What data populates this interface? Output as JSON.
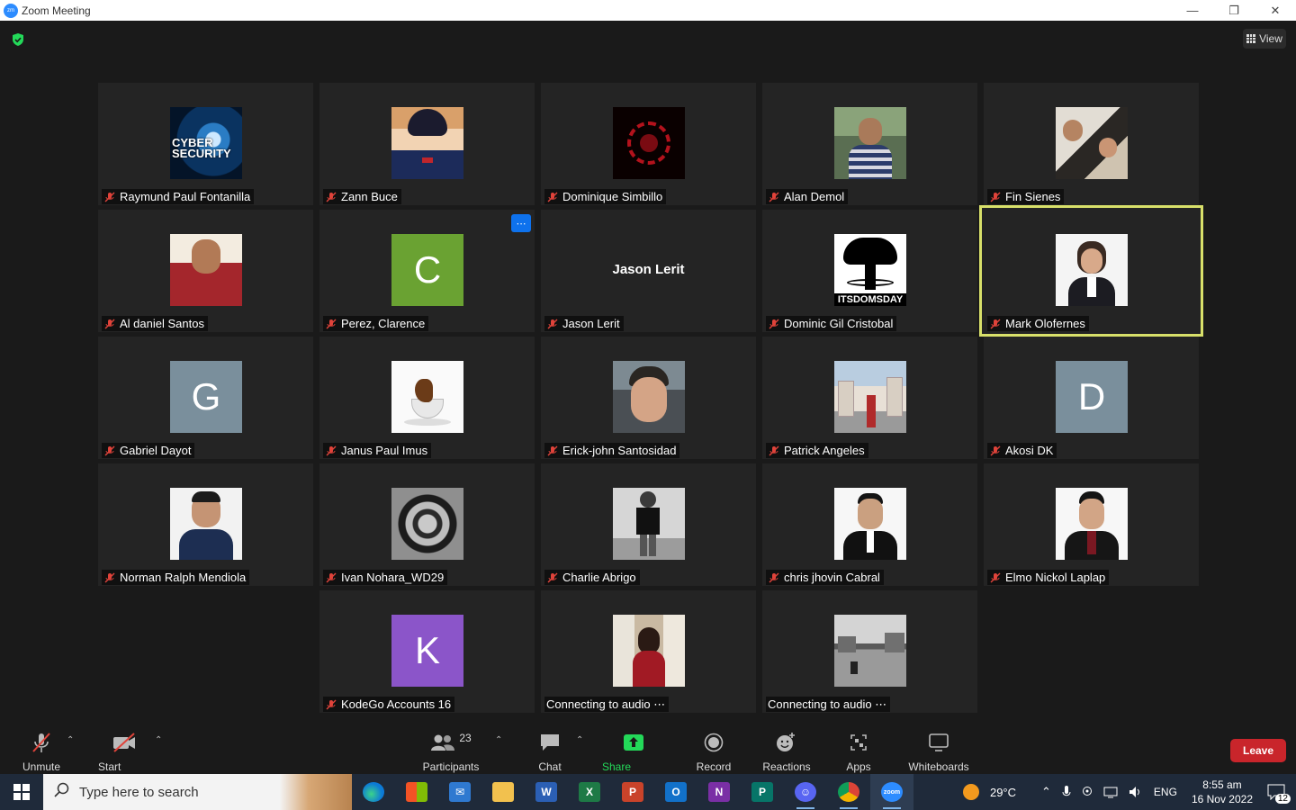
{
  "window": {
    "title": "Zoom Meeting",
    "view_label": "View"
  },
  "participants": [
    {
      "name": "Raymund Paul Fontanilla",
      "avatar": "cyber-security-image",
      "muted": true
    },
    {
      "name": "Zann Buce",
      "avatar": "anime-character-image",
      "muted": true
    },
    {
      "name": "Dominique Simbillo",
      "avatar": "red-sigil-image",
      "muted": true
    },
    {
      "name": "Alan Demol",
      "avatar": "photo",
      "muted": true
    },
    {
      "name": "Fin Sienes",
      "avatar": "photo",
      "muted": true
    },
    {
      "name": "Al daniel Santos",
      "avatar": "photo",
      "muted": true
    },
    {
      "name": "Perez, Clarence",
      "avatar_letter": "C",
      "avatar_color": "#6aa232",
      "muted": true
    },
    {
      "name": "Jason Lerit",
      "big_name": "Jason Lerit",
      "muted": true
    },
    {
      "name": "Dominic Gil Cristobal",
      "avatar": "doomsday-logo",
      "avatar_text": "ITSDOMSDAY",
      "muted": true
    },
    {
      "name": "Mark Olofernes",
      "avatar": "photo",
      "muted": true,
      "active_speaker": true
    },
    {
      "name": "Gabriel Dayot",
      "avatar_letter": "G",
      "avatar_color": "#7a8f9c",
      "muted": true
    },
    {
      "name": "Janus Paul Imus",
      "avatar": "coffee-splash-image",
      "muted": true
    },
    {
      "name": "Erick-john Santosidad",
      "avatar": "photo",
      "muted": true
    },
    {
      "name": "Patrick Angeles",
      "avatar": "photo",
      "muted": true
    },
    {
      "name": "Akosi DK",
      "avatar_letter": "D",
      "avatar_color": "#7a8f9c",
      "muted": true
    },
    {
      "name": "Norman Ralph Mendiola",
      "avatar": "photo",
      "muted": true
    },
    {
      "name": "Ivan Nohara_WD29",
      "avatar": "tattoo-image",
      "muted": true
    },
    {
      "name": "Charlie Abrigo",
      "avatar": "photo",
      "muted": true
    },
    {
      "name": "chris jhovin Cabral",
      "avatar": "photo",
      "muted": true
    },
    {
      "name": "Elmo Nickol Laplap",
      "avatar": "photo",
      "muted": true
    },
    {
      "name": "KodeGo Accounts 16",
      "avatar_letter": "K",
      "avatar_color": "#8b55c9",
      "muted": true
    },
    {
      "name": "Connecting to audio ⋯",
      "avatar": "photo",
      "muted": false
    },
    {
      "name": "Connecting to audio ⋯",
      "avatar": "photo",
      "muted": false
    }
  ],
  "toolbar": {
    "unmute": "Unmute",
    "start_video": "Start Video",
    "participants": "Participants",
    "participants_count": "23",
    "chat": "Chat",
    "share_screen": "Share Screen",
    "record": "Record",
    "reactions": "Reactions",
    "apps": "Apps",
    "whiteboards": "Whiteboards",
    "leave": "Leave"
  },
  "colors": {
    "share_green": "#23d959",
    "leave_red": "#c9252b",
    "active_border": "#d8e06a",
    "mute_red": "#e0433a"
  },
  "taskbar": {
    "search_placeholder": "Type here to search",
    "weather": "29°C",
    "lang": "ENG",
    "time": "8:55 am",
    "date": "16 Nov 2022",
    "notifications": "12",
    "apps": [
      "edge",
      "store",
      "mail",
      "file-explorer",
      "word",
      "excel",
      "powerpoint",
      "outlook",
      "onenote",
      "publisher",
      "discord",
      "chrome",
      "zoom"
    ]
  }
}
